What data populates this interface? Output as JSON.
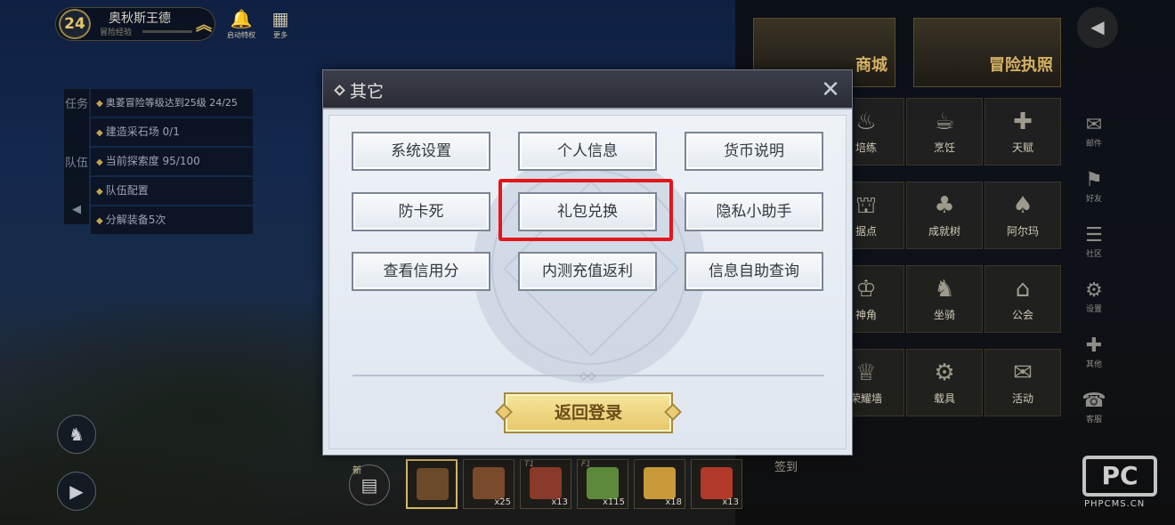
{
  "hud": {
    "level": "24",
    "player_name": "奥秋斯王德",
    "player_subtitle": "冒险经验",
    "buttons": [
      {
        "label": "启动特权",
        "icon": "bell-icon"
      },
      {
        "label": "更多",
        "icon": "grid-icon"
      }
    ]
  },
  "quest": {
    "tab_task": "任务",
    "tab_team": "队伍",
    "items": [
      "奥菱冒险等级达到25级 24/25",
      "建造采石场 0/1",
      "当前探索度 95/100",
      "队伍配置",
      "分解装备5次"
    ]
  },
  "right_menu": {
    "big_tiles": [
      "商城",
      "冒险执照"
    ],
    "tiles": [
      "培练",
      "烹饪",
      "天赋",
      "据点",
      "成就树",
      "阿尔玛",
      "神角",
      "坐骑",
      "公会",
      "荣耀墙",
      "载具",
      "活动"
    ],
    "sign_in": "签到",
    "side_buttons": [
      "邮件",
      "好友",
      "社区",
      "设置",
      "其他",
      "客服"
    ]
  },
  "item_bar": {
    "bag_label": "新",
    "slots": [
      {
        "count": "",
        "key": "",
        "color": "#6b4a2a"
      },
      {
        "count": "x25",
        "key": "",
        "color": "#7a4a2c"
      },
      {
        "count": "x13",
        "key": "T1",
        "color": "#8a3a2a"
      },
      {
        "count": "x115",
        "key": "F1",
        "color": "#5c8a3a"
      },
      {
        "count": "x18",
        "key": "",
        "color": "#c89a3a"
      },
      {
        "count": "x13",
        "key": "",
        "color": "#b23a2a"
      }
    ]
  },
  "dialog": {
    "title": "其它",
    "buttons": [
      "系统设置",
      "个人信息",
      "货币说明",
      "防卡死",
      "礼包兑换",
      "隐私小助手",
      "查看信用分",
      "内测充值返利",
      "信息自助查询"
    ],
    "back_to_login": "返回登录"
  },
  "colors": {
    "highlight": "#e3161b",
    "gold": "#d4b867",
    "dialog_bg": "#e1e7ef"
  },
  "watermark": {
    "logo": "PC",
    "text": "PHPCMS.CN"
  }
}
